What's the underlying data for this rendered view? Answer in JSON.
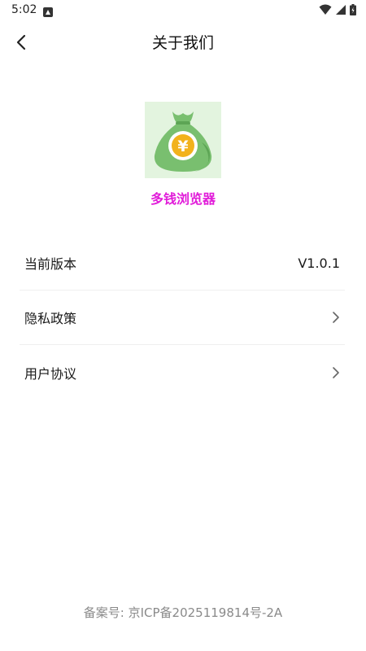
{
  "status_bar": {
    "time": "5:02",
    "notification_icon": "a-box-icon",
    "wifi_icon": "wifi-icon",
    "signal_icon": "cell-signal-icon",
    "battery_icon": "battery-icon"
  },
  "header": {
    "back_icon": "back-chevron-icon",
    "title": "关于我们"
  },
  "app_info": {
    "logo_icon": "money-bag-yen-icon",
    "logo_symbol": "¥",
    "name": "多钱浏览器"
  },
  "settings": {
    "items": [
      {
        "label": "当前版本",
        "value": "V1.0.1"
      },
      {
        "label": "隐私政策",
        "icon": "chevron-right-icon"
      },
      {
        "label": "用户协议",
        "icon": "chevron-right-icon"
      }
    ]
  },
  "footer": {
    "icp": "备案号: 京ICP备2025119814号-2A"
  },
  "colors": {
    "app_name": "#e11cd9",
    "logo_bg": "#e3f4df",
    "bag": "#79bf6f",
    "coin": "#f2b21c"
  }
}
